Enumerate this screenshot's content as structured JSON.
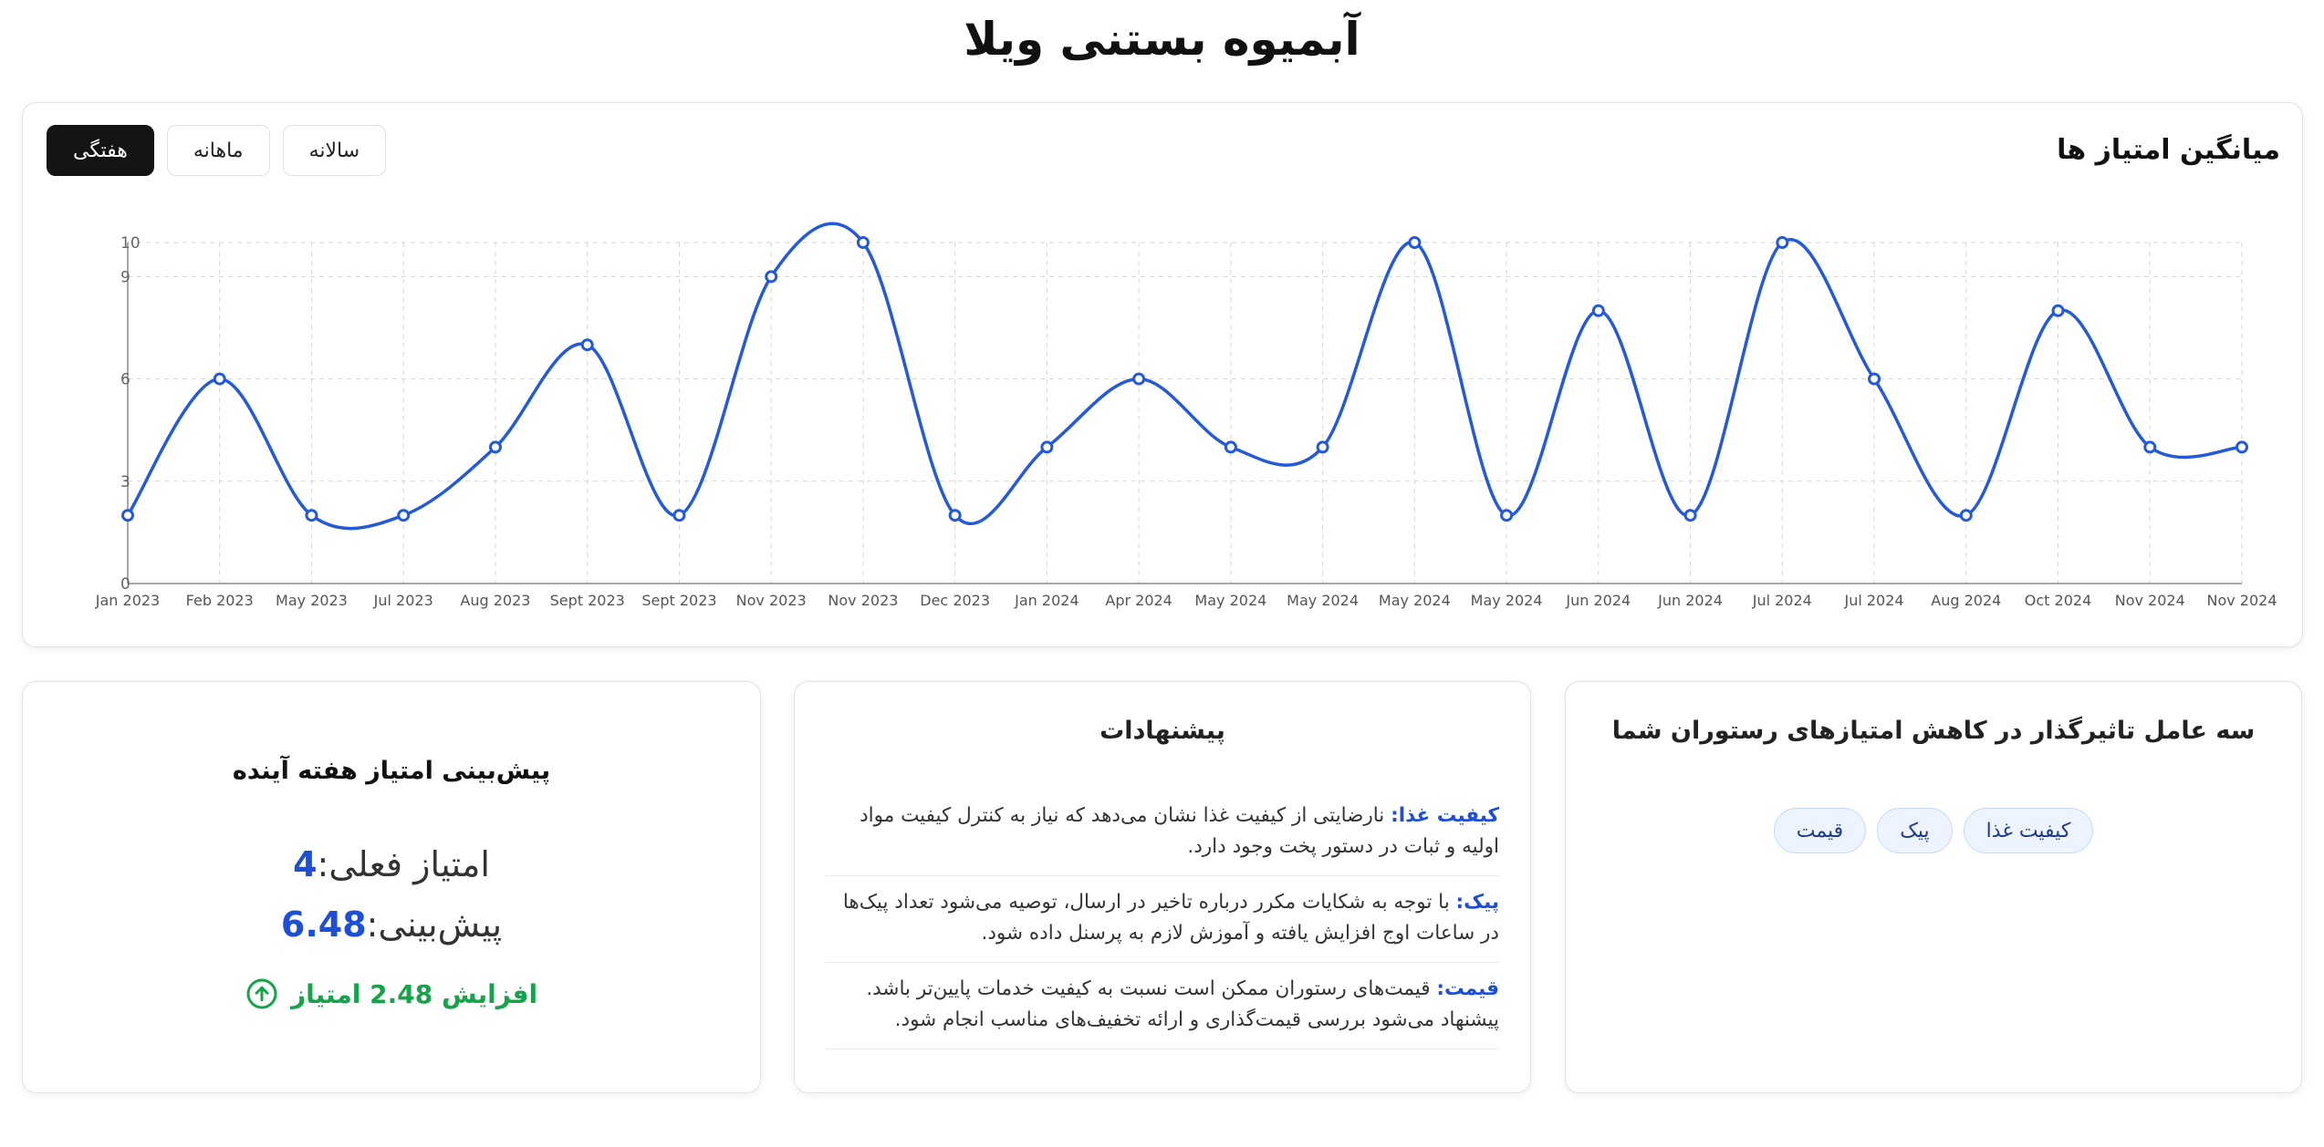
{
  "page": {
    "title": "آبمیوه بستنی ویلا"
  },
  "chart_panel": {
    "title": "میانگین امتیاز ها",
    "tabs": [
      {
        "label": "هفتگی",
        "active": true
      },
      {
        "label": "ماهانه",
        "active": false
      },
      {
        "label": "سالانه",
        "active": false
      }
    ]
  },
  "chart_data": {
    "type": "line",
    "categories": [
      "Jan 2023",
      "Feb 2023",
      "May 2023",
      "Jul 2023",
      "Aug 2023",
      "Sept 2023",
      "Sept 2023",
      "Nov 2023",
      "Nov 2023",
      "Dec 2023",
      "Jan 2024",
      "Apr 2024",
      "May 2024",
      "May 2024",
      "May 2024",
      "May 2024",
      "Jun 2024",
      "Jun 2024",
      "Jul 2024",
      "Jul 2024",
      "Aug 2024",
      "Oct 2024",
      "Nov 2024",
      "Nov 2024"
    ],
    "series": [
      {
        "values": [
          2,
          6,
          2,
          2,
          4,
          7,
          2,
          9,
          10,
          2,
          4,
          6,
          4,
          4,
          10,
          2,
          8,
          2,
          10,
          6,
          2,
          8,
          4,
          4
        ]
      }
    ],
    "yticks": [
      0,
      3,
      6,
      9,
      10
    ],
    "ylim": [
      0,
      10
    ],
    "grid": true,
    "line_color": "#2459d8",
    "smooth": true
  },
  "forecast": {
    "title": "پیش‌بینی امتیاز هفته آینده",
    "current_label": "امتیاز فعلی:",
    "current_value": "4",
    "predicted_label": "پیش‌بینی:",
    "predicted_value": "6.48",
    "change_text": "افزایش 2.48 امتیاز",
    "change_icon": "arrow-up-circle-icon",
    "change_color": "#16a34a"
  },
  "suggestions": {
    "title": "پیشنهادات",
    "items": [
      {
        "key": "کیفیت غذا:",
        "text": " نارضایتی از کیفیت غذا نشان می‌دهد که نیاز به کنترل کیفیت مواد اولیه و ثبات در دستور پخت وجود دارد."
      },
      {
        "key": "پیک:",
        "text": " با توجه به شکایات مکرر درباره تاخیر در ارسال، توصیه می‌شود تعداد پیک‌ها در ساعات اوج افزایش یافته و آموزش لازم به پرسنل داده شود."
      },
      {
        "key": "قیمت:",
        "text": " قیمت‌های رستوران ممکن است نسبت به کیفیت خدمات پایین‌تر باشد. پیشنهاد می‌شود بررسی قیمت‌گذاری و ارائه تخفیف‌های مناسب انجام شود."
      }
    ]
  },
  "factors": {
    "title": "سه عامل تاثیرگذار در کاهش امتیازهای رستوران شما",
    "tags": [
      "کیفیت غذا",
      "پیک",
      "قیمت"
    ]
  },
  "colors": {
    "accent": "#1d4ed8",
    "tag_bg": "#eef4ff",
    "positive": "#16a34a"
  }
}
